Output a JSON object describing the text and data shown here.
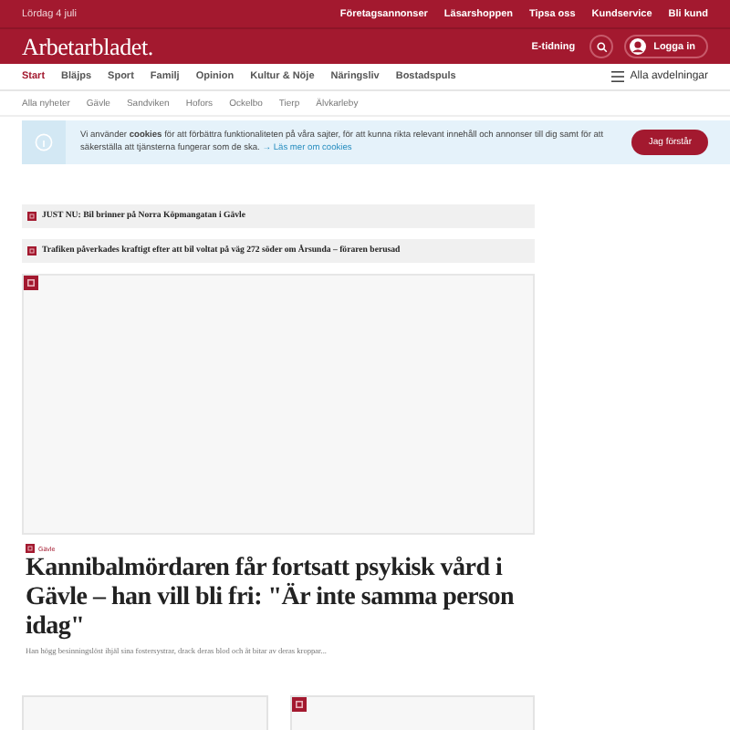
{
  "top_bar": {
    "date": "Lördag 4 juli",
    "links": [
      "Företagsannonser",
      "Läsarshoppen",
      "Tipsa oss",
      "Kundservice",
      "Bli kund"
    ]
  },
  "header": {
    "logo": "Arbetarbladet.",
    "e_paper": "E-tidning",
    "login": "Logga in"
  },
  "nav": {
    "items": [
      {
        "label": "Start",
        "selected": true
      },
      {
        "label": "Bläjps",
        "selected": false
      },
      {
        "label": "Sport",
        "selected": false
      },
      {
        "label": "Familj",
        "selected": false
      },
      {
        "label": "Opinion",
        "selected": false
      },
      {
        "label": "Kultur & Nöje",
        "selected": false
      },
      {
        "label": "Näringsliv",
        "selected": false
      },
      {
        "label": "Bostadspuls",
        "selected": false
      }
    ],
    "all_sections": "Alla avdelningar"
  },
  "subnav": [
    "Alla nyheter",
    "Gävle",
    "Sandviken",
    "Hofors",
    "Ockelbo",
    "Tierp",
    "Älvkarleby"
  ],
  "cookie_banner": {
    "text": "Vi använder **cookies** för att förbättra funktionaliteten på våra sajter, för att kunna rikta relevant innehåll och annonser till dig samt för att säkerställa att tjänsterna fungerar som de ska.",
    "link": "→ Läs mer om cookies",
    "button": "Jag förstår"
  },
  "news_ticker": [
    "**JUST NU:** Bil brinner på Norra Köpmangatan i Gävle",
    "Trafiken påverkades kraftigt efter att bil voltat på väg 272 söder om Årsunda – föraren berusad"
  ],
  "main_article": {
    "tag": "Gävle",
    "title": "Kannibalmördaren får fortsatt psykisk vård i Gävle – han vill bli fri: \"Är inte samma person idag\"",
    "summary": "Han högg besinningslöst ihjäl sina fostersystrar, drack deras blod och åt bitar av deras kroppar..."
  },
  "bottom_cards": [
    {
      "badge": false
    },
    {
      "badge": true
    }
  ]
}
